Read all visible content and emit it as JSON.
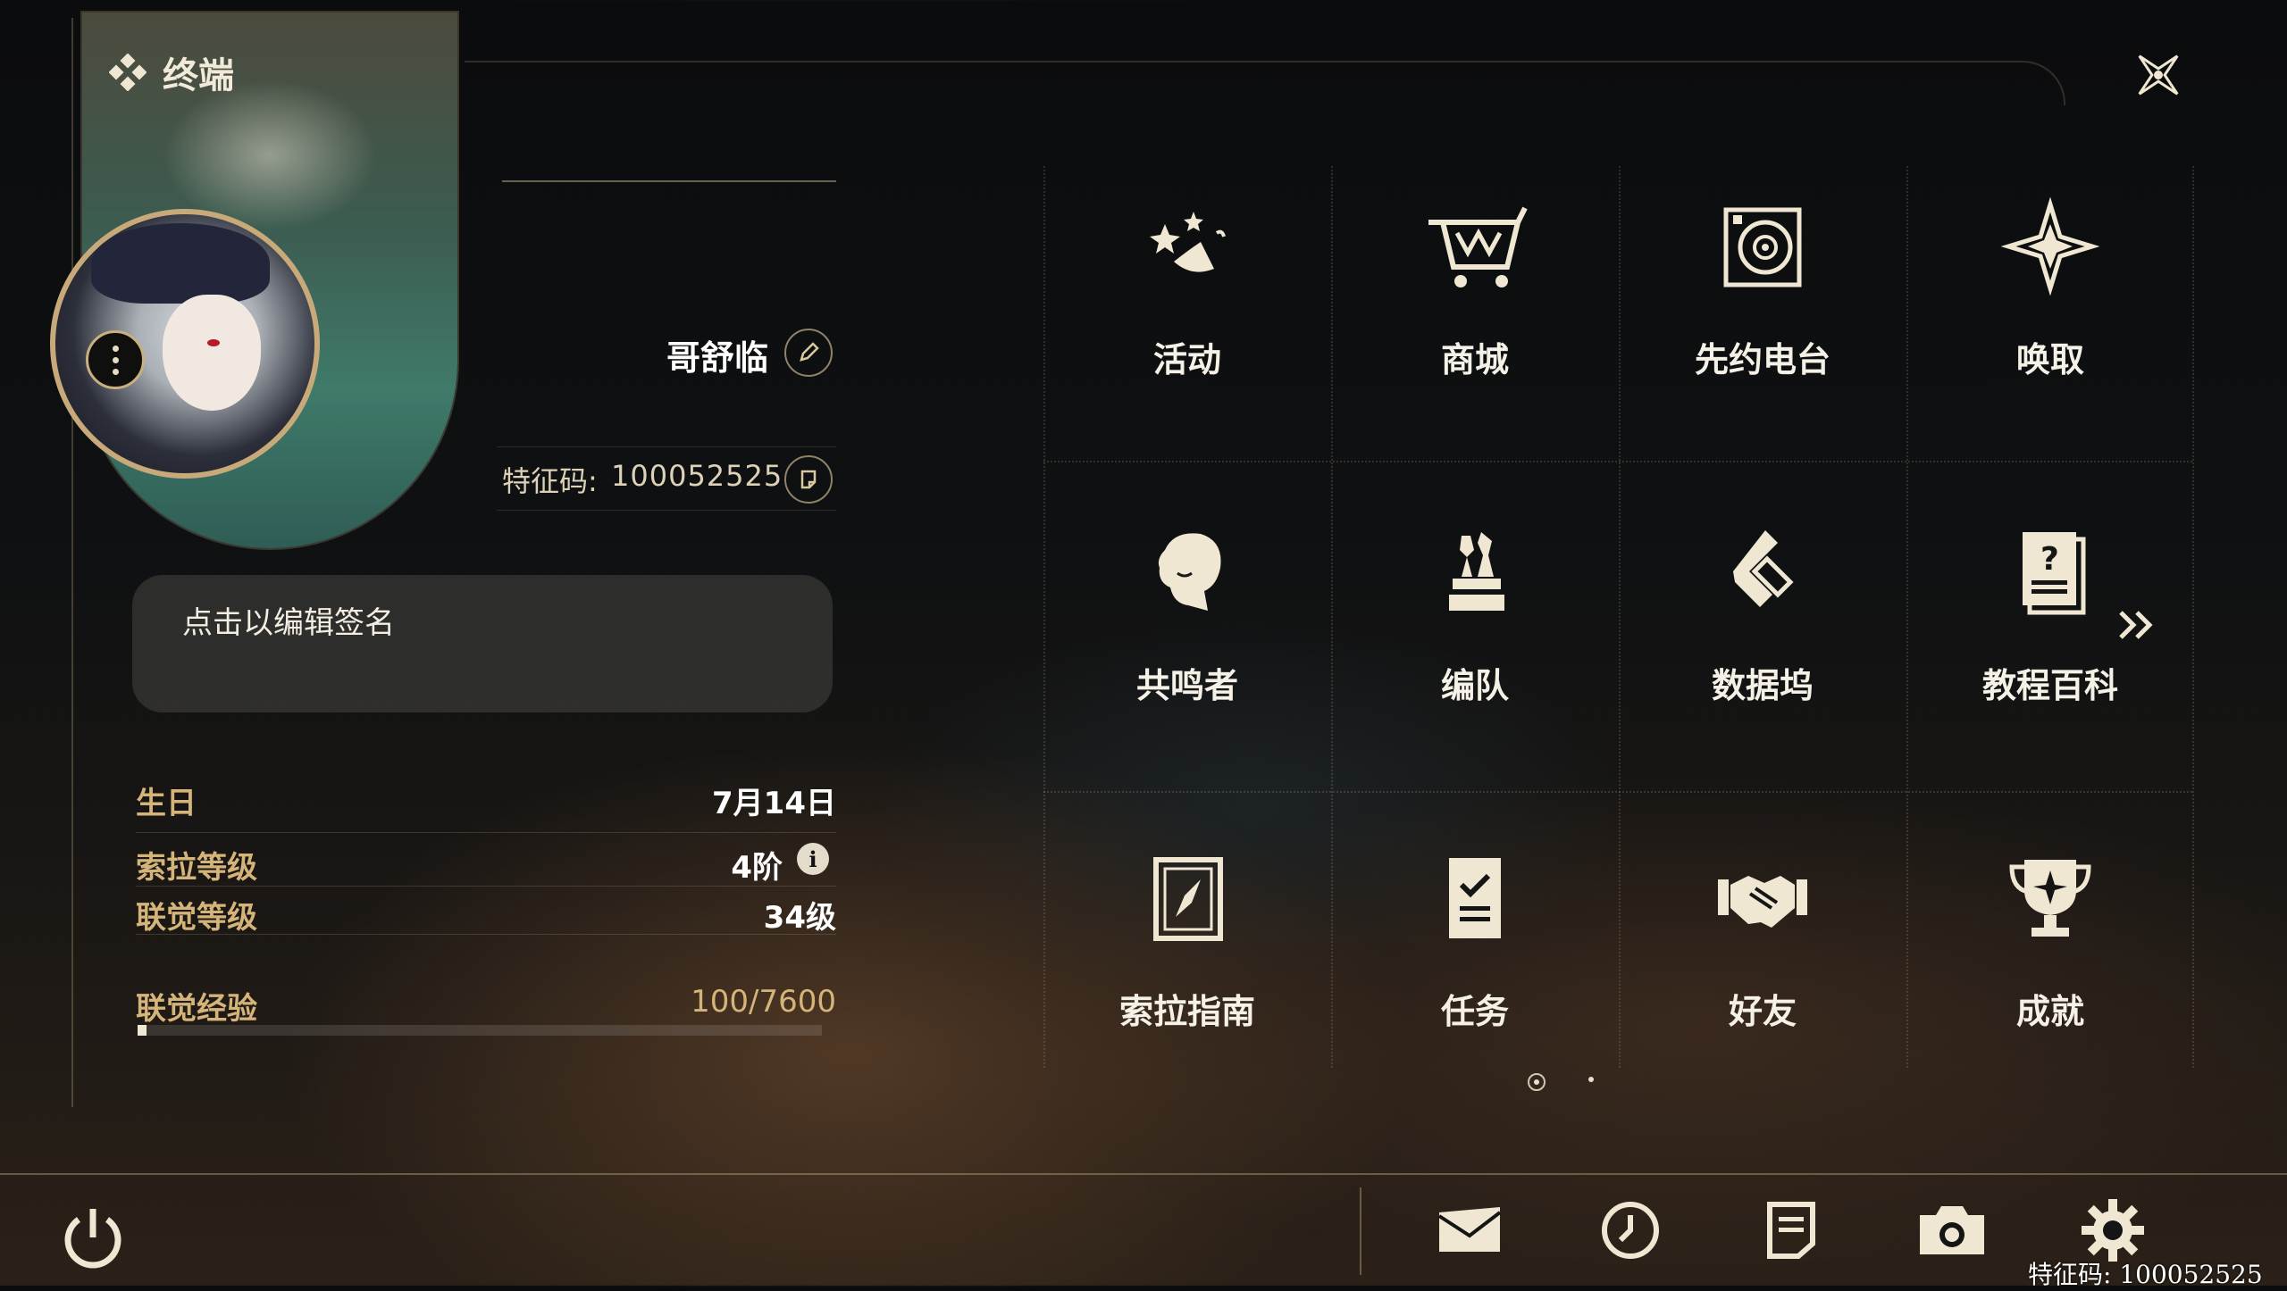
{
  "header": {
    "title": "终端"
  },
  "profile": {
    "name": "哥舒临",
    "uid_label": "特征码:",
    "uid": "100052525",
    "signature_placeholder": "点击以编辑签名"
  },
  "stats": {
    "birthday_label": "生日",
    "birthday": "7月14日",
    "sola_level_label": "索拉等级",
    "sola_level": "4阶",
    "union_level_label": "联觉等级",
    "union_level": "34级",
    "union_exp_label": "联觉经验",
    "union_exp": "100/7600",
    "union_exp_fraction": 0.0132
  },
  "menu": {
    "items": [
      {
        "label": "活动",
        "icon": "activity-stars-icon"
      },
      {
        "label": "商城",
        "icon": "shopping-cart-icon"
      },
      {
        "label": "先约电台",
        "icon": "radio-speaker-icon"
      },
      {
        "label": "唤取",
        "icon": "compass-star-icon"
      },
      {
        "label": "共鸣者",
        "icon": "character-head-icon"
      },
      {
        "label": "编队",
        "icon": "chess-pieces-icon"
      },
      {
        "label": "数据坞",
        "icon": "data-dock-icon"
      },
      {
        "label": "教程百科",
        "icon": "tutorial-book-icon"
      },
      {
        "label": "索拉指南",
        "icon": "guide-compass-icon"
      },
      {
        "label": "任务",
        "icon": "task-checklist-icon"
      },
      {
        "label": "好友",
        "icon": "handshake-icon"
      },
      {
        "label": "成就",
        "icon": "trophy-icon"
      }
    ],
    "page_current": 1,
    "page_total": 2
  },
  "footer": {
    "uid_text": "特征码: 100052525",
    "buttons": [
      "mail-icon",
      "clock-icon",
      "notice-icon",
      "camera-icon",
      "settings-gear-icon",
      "power-icon"
    ]
  },
  "colors": {
    "accent_gold": "#d5b47a",
    "text_light": "#f6f1e6",
    "panel": "#46463f"
  }
}
